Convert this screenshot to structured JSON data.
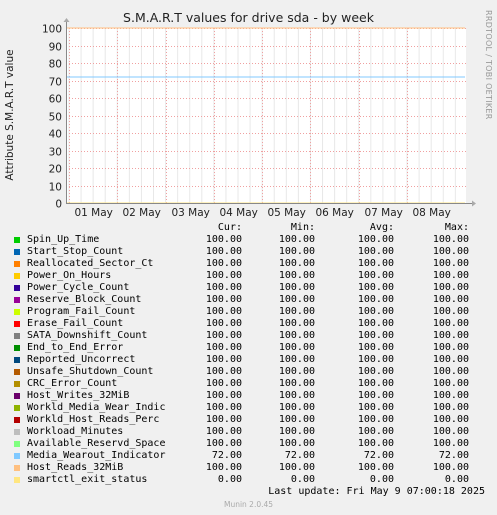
{
  "chart_data": {
    "type": "line",
    "title": "S.M.A.R.T values for drive sda - by week",
    "ylabel": "Attribute S.M.A.R.T value",
    "ylim": [
      0,
      100
    ],
    "y_ticks": [
      "0",
      "10",
      "20",
      "30",
      "40",
      "50",
      "60",
      "70",
      "80",
      "90",
      "100"
    ],
    "x_ticks": [
      "01 May",
      "02 May",
      "03 May",
      "04 May",
      "05 May",
      "06 May",
      "07 May",
      "08 May"
    ],
    "grid": true,
    "series": [
      {
        "name": "Spin_Up_Time",
        "color": "#00cc00",
        "values": [
          100,
          100
        ]
      },
      {
        "name": "Start_Stop_Count",
        "color": "#0066b3",
        "values": [
          100,
          100
        ]
      },
      {
        "name": "Reallocated_Sector_Ct",
        "color": "#ff8000",
        "values": [
          100,
          100
        ]
      },
      {
        "name": "Power_On_Hours",
        "color": "#ffcc00",
        "values": [
          100,
          100
        ]
      },
      {
        "name": "Power_Cycle_Count",
        "color": "#330099",
        "values": [
          100,
          100
        ]
      },
      {
        "name": "Reserve_Block_Count",
        "color": "#990099",
        "values": [
          100,
          100
        ]
      },
      {
        "name": "Program_Fail_Count",
        "color": "#ccff00",
        "values": [
          100,
          100
        ]
      },
      {
        "name": "Erase_Fail_Count",
        "color": "#ff0000",
        "values": [
          100,
          100
        ]
      },
      {
        "name": "SATA_Downshift_Count",
        "color": "#808080",
        "values": [
          100,
          100
        ]
      },
      {
        "name": "End_to_End_Error",
        "color": "#008f00",
        "values": [
          100,
          100
        ]
      },
      {
        "name": "Reported_Uncorrect",
        "color": "#00487d",
        "values": [
          100,
          100
        ]
      },
      {
        "name": "Unsafe_Shutdown_Count",
        "color": "#b35a00",
        "values": [
          100,
          100
        ]
      },
      {
        "name": "CRC_Error_Count",
        "color": "#b38f00",
        "values": [
          100,
          100
        ]
      },
      {
        "name": "Host_Writes_32MiB",
        "color": "#6b006b",
        "values": [
          100,
          100
        ]
      },
      {
        "name": "Workld_Media_Wear_Indic",
        "color": "#8fb300",
        "values": [
          100,
          100
        ]
      },
      {
        "name": "Workld_Host_Reads_Perc",
        "color": "#b30000",
        "values": [
          100,
          100
        ]
      },
      {
        "name": "Workload_Minutes",
        "color": "#bebebe",
        "values": [
          100,
          100
        ]
      },
      {
        "name": "Available_Reservd_Space",
        "color": "#80ff80",
        "values": [
          100,
          100
        ]
      },
      {
        "name": "Media_Wearout_Indicator",
        "color": "#80c9ff",
        "values": [
          72,
          72
        ]
      },
      {
        "name": "Host_Reads_32MiB",
        "color": "#ffc080",
        "values": [
          100,
          100
        ]
      },
      {
        "name": "smartctl_exit_status",
        "color": "#ffe680",
        "values": [
          0,
          0
        ]
      }
    ]
  },
  "side_label": "RRDTOOL / TOBI OETIKER",
  "legend": {
    "headers": {
      "cur": "Cur:",
      "min": "Min:",
      "avg": "Avg:",
      "max": "Max:"
    },
    "rows": [
      {
        "name": "Spin_Up_Time",
        "cur": "100.00",
        "min": "100.00",
        "avg": "100.00",
        "max": "100.00"
      },
      {
        "name": "Start_Stop_Count",
        "cur": "100.00",
        "min": "100.00",
        "avg": "100.00",
        "max": "100.00"
      },
      {
        "name": "Reallocated_Sector_Ct",
        "cur": "100.00",
        "min": "100.00",
        "avg": "100.00",
        "max": "100.00"
      },
      {
        "name": "Power_On_Hours",
        "cur": "100.00",
        "min": "100.00",
        "avg": "100.00",
        "max": "100.00"
      },
      {
        "name": "Power_Cycle_Count",
        "cur": "100.00",
        "min": "100.00",
        "avg": "100.00",
        "max": "100.00"
      },
      {
        "name": "Reserve_Block_Count",
        "cur": "100.00",
        "min": "100.00",
        "avg": "100.00",
        "max": "100.00"
      },
      {
        "name": "Program_Fail_Count",
        "cur": "100.00",
        "min": "100.00",
        "avg": "100.00",
        "max": "100.00"
      },
      {
        "name": "Erase_Fail_Count",
        "cur": "100.00",
        "min": "100.00",
        "avg": "100.00",
        "max": "100.00"
      },
      {
        "name": "SATA_Downshift_Count",
        "cur": "100.00",
        "min": "100.00",
        "avg": "100.00",
        "max": "100.00"
      },
      {
        "name": "End_to_End_Error",
        "cur": "100.00",
        "min": "100.00",
        "avg": "100.00",
        "max": "100.00"
      },
      {
        "name": "Reported_Uncorrect",
        "cur": "100.00",
        "min": "100.00",
        "avg": "100.00",
        "max": "100.00"
      },
      {
        "name": "Unsafe_Shutdown_Count",
        "cur": "100.00",
        "min": "100.00",
        "avg": "100.00",
        "max": "100.00"
      },
      {
        "name": "CRC_Error_Count",
        "cur": "100.00",
        "min": "100.00",
        "avg": "100.00",
        "max": "100.00"
      },
      {
        "name": "Host_Writes_32MiB",
        "cur": "100.00",
        "min": "100.00",
        "avg": "100.00",
        "max": "100.00"
      },
      {
        "name": "Workld_Media_Wear_Indic",
        "cur": "100.00",
        "min": "100.00",
        "avg": "100.00",
        "max": "100.00"
      },
      {
        "name": "Workld_Host_Reads_Perc",
        "cur": "100.00",
        "min": "100.00",
        "avg": "100.00",
        "max": "100.00"
      },
      {
        "name": "Workload_Minutes",
        "cur": "100.00",
        "min": "100.00",
        "avg": "100.00",
        "max": "100.00"
      },
      {
        "name": "Available_Reservd_Space",
        "cur": "100.00",
        "min": "100.00",
        "avg": "100.00",
        "max": "100.00"
      },
      {
        "name": "Media_Wearout_Indicator",
        "cur": "72.00",
        "min": "72.00",
        "avg": "72.00",
        "max": "72.00"
      },
      {
        "name": "Host_Reads_32MiB",
        "cur": "100.00",
        "min": "100.00",
        "avg": "100.00",
        "max": "100.00"
      },
      {
        "name": "smartctl_exit_status",
        "cur": "0.00",
        "min": "0.00",
        "avg": "0.00",
        "max": "0.00"
      }
    ]
  },
  "last_update": "Last update: Fri May  9 07:00:18 2025",
  "footer": "Munin 2.0.45"
}
